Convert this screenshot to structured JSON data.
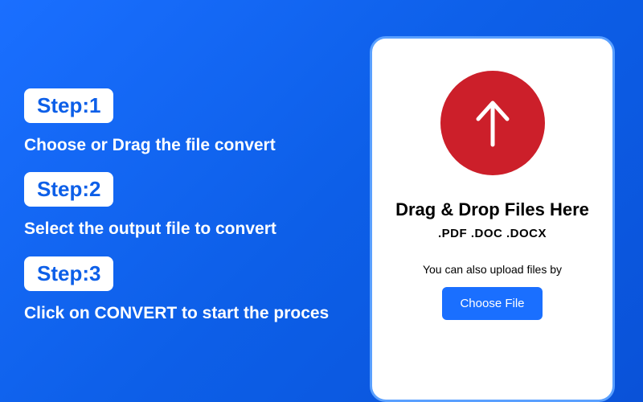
{
  "steps": [
    {
      "badge": "Step:1",
      "text": "Choose or Drag the file convert"
    },
    {
      "badge": "Step:2",
      "text": "Select the output file to convert"
    },
    {
      "badge": "Step:3",
      "text": "Click on CONVERT to start the proces"
    }
  ],
  "upload": {
    "drag_title": "Drag & Drop Files Here",
    "file_types": ".PDF   .DOC   .DOCX",
    "hint": "You can also upload files by",
    "button_label": "Choose File"
  }
}
